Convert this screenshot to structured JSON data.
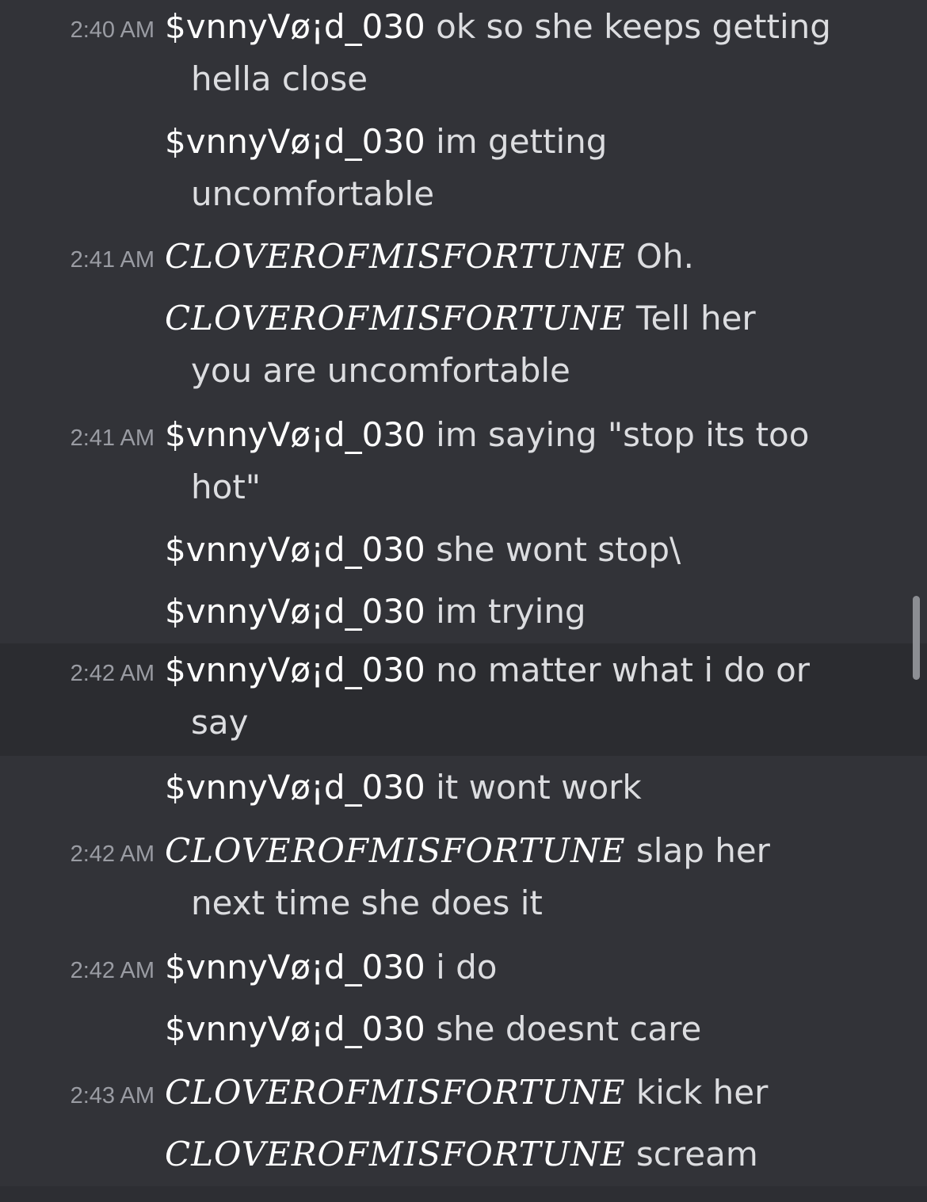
{
  "messages": [
    {
      "ts": "2:40 AM",
      "user": "$vnnyVø¡d_030",
      "style": "void",
      "lines": [
        "ok so she keeps getting",
        "hella close"
      ]
    },
    {
      "ts": "",
      "user": "$vnnyVø¡d_030",
      "style": "void",
      "lines": [
        "im getting",
        "uncomfortable"
      ]
    },
    {
      "ts": "2:41 AM",
      "user": "CLOVEROFMISFORTUNE",
      "style": "clover",
      "lines": [
        "Oh."
      ]
    },
    {
      "ts": "",
      "user": "CLOVEROFMISFORTUNE",
      "style": "clover",
      "lines": [
        "Tell her",
        "you are uncomfortable"
      ]
    },
    {
      "ts": "2:41 AM",
      "user": "$vnnyVø¡d_030",
      "style": "void",
      "lines": [
        "im saying \"stop its too",
        "hot\""
      ]
    },
    {
      "ts": "",
      "user": "$vnnyVø¡d_030",
      "style": "void",
      "lines": [
        "she wont stop\\"
      ]
    },
    {
      "ts": "",
      "user": "$vnnyVø¡d_030",
      "style": "void",
      "lines": [
        "im trying"
      ]
    },
    {
      "ts": "2:42 AM",
      "user": "$vnnyVø¡d_030",
      "style": "void",
      "lines": [
        "no matter what i do or",
        "say"
      ],
      "highlighted": true
    },
    {
      "ts": "",
      "user": "$vnnyVø¡d_030",
      "style": "void",
      "lines": [
        "it wont work"
      ]
    },
    {
      "ts": "2:42 AM",
      "user": "CLOVEROFMISFORTUNE",
      "style": "clover",
      "lines": [
        "slap her",
        "next time she does it"
      ]
    },
    {
      "ts": "2:42 AM",
      "user": "$vnnyVø¡d_030",
      "style": "void",
      "lines": [
        "i do"
      ]
    },
    {
      "ts": "",
      "user": "$vnnyVø¡d_030",
      "style": "void",
      "lines": [
        "she doesnt care"
      ]
    },
    {
      "ts": "2:43 AM",
      "user": "CLOVEROFMISFORTUNE",
      "style": "clover",
      "lines": [
        "kick her"
      ]
    },
    {
      "ts": "",
      "user": "CLOVEROFMISFORTUNE",
      "style": "clover",
      "lines": [
        "scream"
      ]
    }
  ]
}
